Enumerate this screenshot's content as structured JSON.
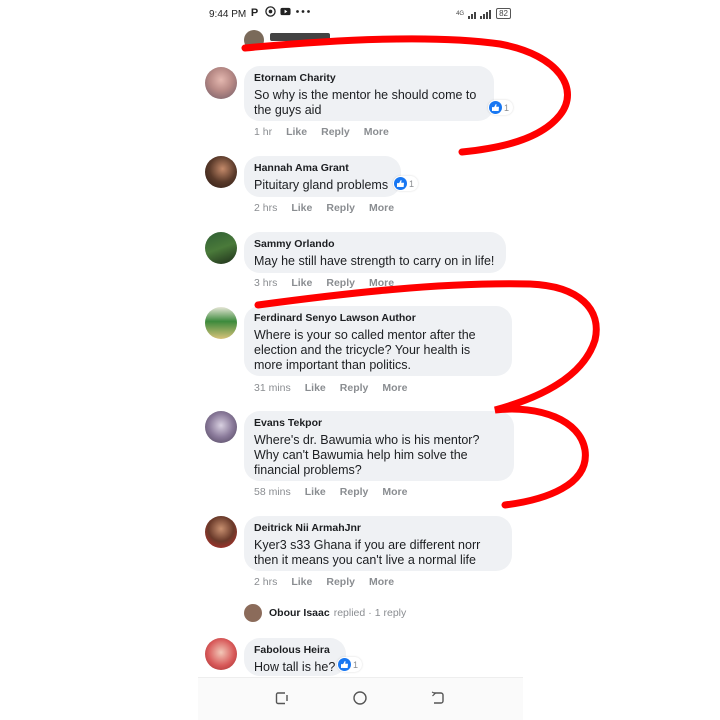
{
  "status": {
    "time": "9:44 PM",
    "battery": "82",
    "network": "4G"
  },
  "top_partial": {
    "name": "Comment author (partially hidden)"
  },
  "comments": [
    {
      "name": "Etornam Charity",
      "text": "So why is the mentor he should come to the guys aid",
      "time": "1 hr",
      "like": "Like",
      "reply": "Reply",
      "more": "More",
      "reactions": "1"
    },
    {
      "name": "Hannah Ama Grant",
      "text": "Pituitary gland problems",
      "time": "2 hrs",
      "like": "Like",
      "reply": "Reply",
      "more": "More",
      "reactions": "1"
    },
    {
      "name": "Sammy Orlando",
      "text": "May he still have strength to carry on in life!",
      "time": "3 hrs",
      "like": "Like",
      "reply": "Reply",
      "more": "More"
    },
    {
      "name": "Ferdinard Senyo Lawson Author",
      "text": "Where is your so called mentor after the election and the tricycle? Your health is more important than politics.",
      "time": "31 mins",
      "like": "Like",
      "reply": "Reply",
      "more": "More"
    },
    {
      "name": "Evans Tekpor",
      "text": "Where's dr. Bawumia who is his mentor? Why can't Bawumia help him solve the financial problems?",
      "time": "58 mins",
      "like": "Like",
      "reply": "Reply",
      "more": "More"
    },
    {
      "name": "Deitrick Nii ArmahJnr",
      "text": "Kyer3 s33 Ghana if you are different norr then it means you can't live a normal life",
      "time": "2 hrs",
      "like": "Like",
      "reply": "Reply",
      "more": "More"
    },
    {
      "name": "Fabolous Heira",
      "text": "How tall is he?",
      "reactions": "1"
    }
  ],
  "reply_summary": {
    "name": "Obour Isaac",
    "verb": "replied",
    "sep": "·",
    "count": "1 reply"
  },
  "colors": {
    "bubble": "#eff1f4",
    "like_blue": "#1877f2",
    "annotation_red": "#ff0000",
    "meta_gray": "#8a8d91"
  },
  "icons": [
    "p-app-icon",
    "whatsapp-icon",
    "youtube-icon",
    "more-dots-icon",
    "signal-icon",
    "battery-icon",
    "like-reaction-icon",
    "recent-apps-icon",
    "home-icon",
    "back-icon"
  ]
}
